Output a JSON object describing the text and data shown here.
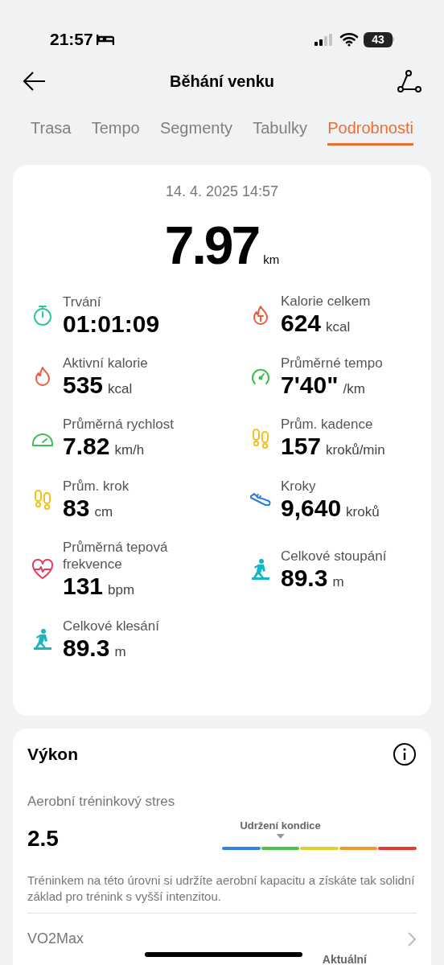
{
  "status_bar": {
    "time": "21:57",
    "battery": "43"
  },
  "header": {
    "title": "Běhání venku"
  },
  "tabs": [
    {
      "label": "Trasa",
      "selected": false
    },
    {
      "label": "Tempo",
      "selected": false
    },
    {
      "label": "Segmenty",
      "selected": false
    },
    {
      "label": "Tabulky",
      "selected": false
    },
    {
      "label": "Podrobnosti",
      "selected": true
    }
  ],
  "summary": {
    "date": "14. 4. 2025 14:57",
    "distance": "7.97",
    "distance_unit": "km"
  },
  "metrics": [
    {
      "kind": "stopwatch",
      "label": "Trvání",
      "value": "01:01:09"
    },
    {
      "kind": "flame-t",
      "label": "Kalorie celkem",
      "value": "624",
      "unit": "kcal"
    },
    {
      "kind": "flame",
      "label": "Aktivní kalorie",
      "value": "535",
      "unit": "kcal"
    },
    {
      "kind": "gauge-small",
      "label": "Průměrné tempo",
      "value": "7'40\"",
      "unit": "/km"
    },
    {
      "kind": "gauge",
      "label": "Průměrná rychlost",
      "value": "7.82",
      "unit": "km/h"
    },
    {
      "kind": "footprints",
      "label": "Prům. kadence",
      "value": "157",
      "unit": "kroků/min"
    },
    {
      "kind": "footprints",
      "label": "Prům. krok",
      "value": "83",
      "unit": "cm"
    },
    {
      "kind": "shoe",
      "label": "Kroky",
      "value": "9,640",
      "unit": "kroků"
    },
    {
      "kind": "heart",
      "label": "Průměrná tepová frekvence",
      "value": "131",
      "unit": "bpm"
    },
    {
      "kind": "hiker",
      "label": "Celkové stoupání",
      "value": "89.3",
      "unit": "m"
    },
    {
      "kind": "hiker",
      "label": "Celkové klesání",
      "value": "89.3",
      "unit": "m"
    }
  ],
  "performance": {
    "title": "Výkon",
    "stress_label": "Aerobní tréninkový stres",
    "stress_value": "2.5",
    "zone_label": "Udržení kondice",
    "description": "Tréninkem na této úrovni si udržíte aerobní kapacitu a získáte tak solidní základ pro trénink s vyšší intenzitou.",
    "vo2max_label": "VO2Max",
    "current_label": "Aktuální"
  }
}
